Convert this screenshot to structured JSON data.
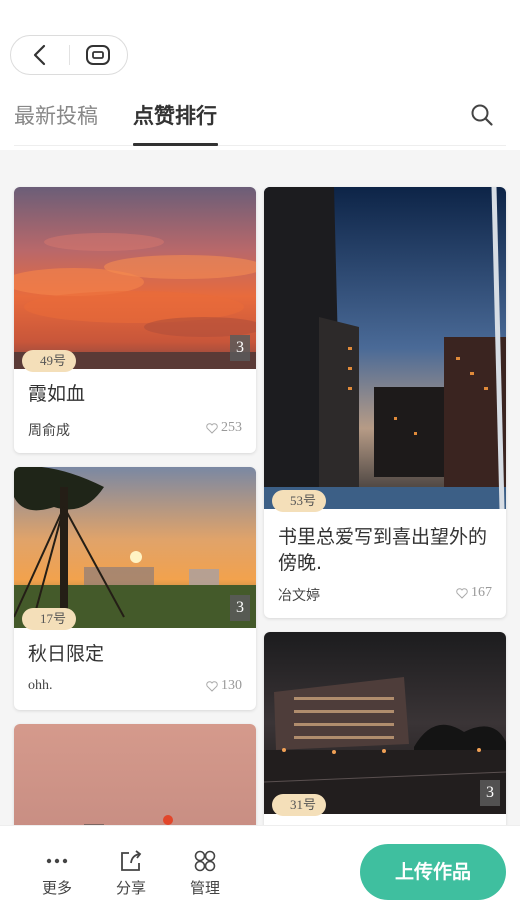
{
  "nav": {
    "back_icon": "chevron-left-icon",
    "home_icon": "capsule-home-icon"
  },
  "tabs": [
    {
      "label": "最新投稿",
      "active": false
    },
    {
      "label": "点赞排行",
      "active": true
    }
  ],
  "search_icon": "search-icon",
  "cards": [
    {
      "number": "49号",
      "count": "3",
      "title": "霞如血",
      "author": "周俞成",
      "likes": "253"
    },
    {
      "number": "53号",
      "count": "",
      "title": "书里总爱写到喜出望外的傍晚.",
      "author": "冶文婷",
      "likes": "167"
    },
    {
      "number": "17号",
      "count": "3",
      "title": "秋日限定",
      "author": "ohh.",
      "likes": "130"
    },
    {
      "number": "31号",
      "count": "3",
      "title": "",
      "author": "",
      "likes": ""
    }
  ],
  "bottom": {
    "more_label": "更多",
    "share_label": "分享",
    "manage_label": "管理",
    "upload_label": "上传作品"
  },
  "colors": {
    "accent": "#3fbf9f",
    "badge": "#f4dfb9"
  }
}
